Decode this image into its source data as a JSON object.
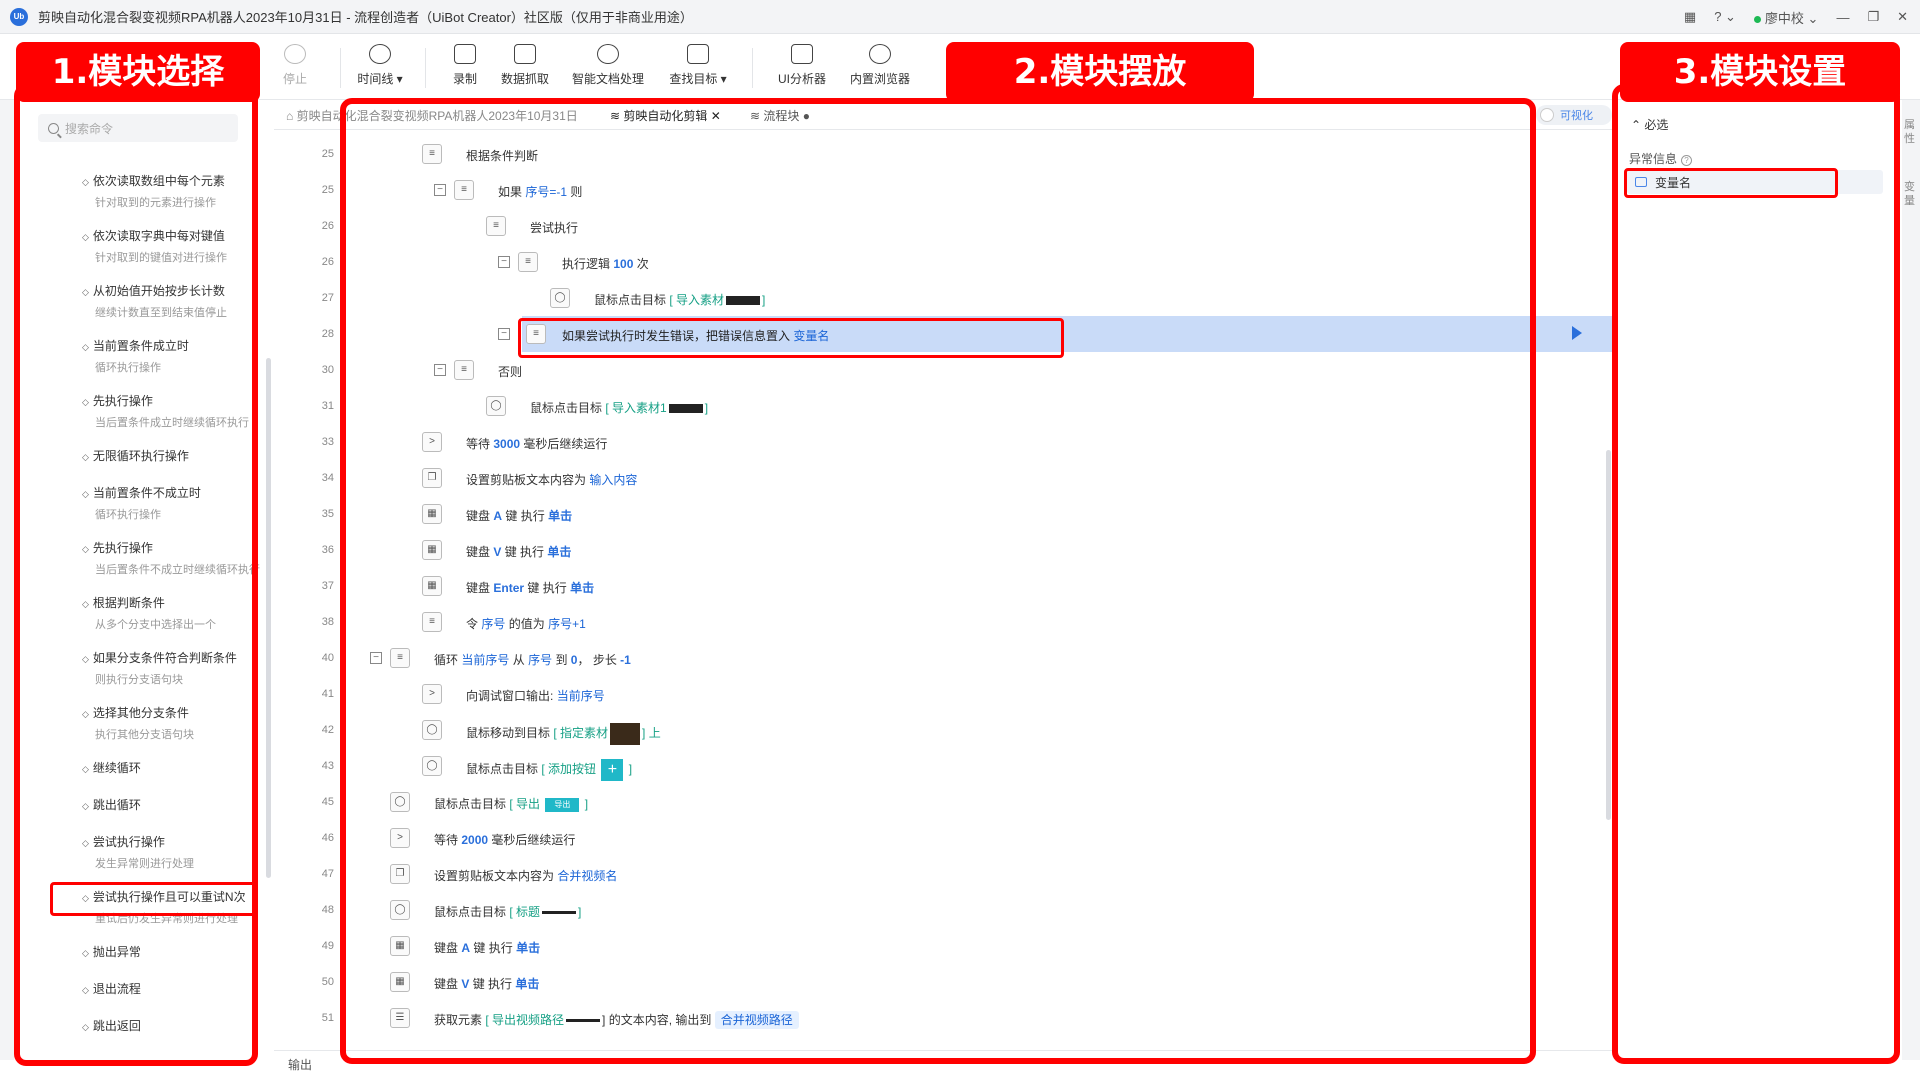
{
  "window": {
    "title": "剪映自动化混合裂变视频RPA机器人2023年10月31日 - 流程创造者（UiBot Creator）社区版（仅用于非商业用途）",
    "logo": "Ub",
    "help": "? ⌄",
    "user": "廖中校 ⌄",
    "minimize": "—",
    "restore": "❐",
    "close": "✕"
  },
  "toolbar": {
    "stop": "停止",
    "timeline": "时间线 ▾",
    "record": "录制",
    "data_capture": "数据抓取",
    "smart_doc": "智能文档处理",
    "find_target": "查找目标 ▾",
    "ui_analyzer": "UI分析器",
    "builtin_browser": "内置浏览器"
  },
  "left": {
    "search_placeholder": "搜索命令",
    "commands": [
      {
        "title": "依次读取数组中每个元素",
        "desc": "针对取到的元素进行操作"
      },
      {
        "title": "依次读取字典中每对键值",
        "desc": "针对取到的键值对进行操作"
      },
      {
        "title": "从初始值开始按步长计数",
        "desc": "继续计数直至到结束值停止"
      },
      {
        "title": "当前置条件成立时",
        "desc": "循环执行操作"
      },
      {
        "title": "先执行操作",
        "desc": "当后置条件成立时继续循环执行"
      },
      {
        "title": "无限循环执行操作",
        "desc": ""
      },
      {
        "title": "当前置条件不成立时",
        "desc": "循环执行操作"
      },
      {
        "title": "先执行操作",
        "desc": "当后置条件不成立时继续循环执行"
      },
      {
        "title": "根据判断条件",
        "desc": "从多个分支中选择出一个"
      },
      {
        "title": "如果分支条件符合判断条件",
        "desc": "则执行分支语句块"
      },
      {
        "title": "选择其他分支条件",
        "desc": "执行其他分支语句块"
      },
      {
        "title": "继续循环",
        "desc": ""
      },
      {
        "title": "跳出循环",
        "desc": ""
      },
      {
        "title": "尝试执行操作",
        "desc": "发生异常则进行处理"
      },
      {
        "title": "尝试执行操作且可以重试N次",
        "desc": "重试后仍发生异常则进行处理"
      },
      {
        "title": "抛出异常",
        "desc": ""
      },
      {
        "title": "退出流程",
        "desc": ""
      },
      {
        "title": "跳出返回",
        "desc": ""
      }
    ]
  },
  "editor": {
    "tabs": {
      "main": "剪映自动化混合裂变视频RPA机器人2023年10月31日",
      "active": "剪映自动化剪辑 ✕",
      "flow": "流程块 ●"
    },
    "visual_toggle": "可视化",
    "output_label": "输出",
    "rows": {
      "r1": {
        "ln": "25",
        "text": "根据条件判断"
      },
      "r2": {
        "ln": "25",
        "a": "如果",
        "b": "序号=-1",
        "c": "则"
      },
      "r3": {
        "ln": "26",
        "text": "尝试执行"
      },
      "r4": {
        "ln": "26",
        "a": "执行逻辑",
        "b": "100",
        "c": "次"
      },
      "r5": {
        "ln": "27",
        "a": "鼠标点击目标",
        "b": "[ 导入素材",
        "c": "]"
      },
      "r6": {
        "ln": "28",
        "a": "如果尝试执行时发生错误，把错误信息置入",
        "b": "变量名"
      },
      "r7": {
        "ln": "30",
        "text": "否则"
      },
      "r8": {
        "ln": "31",
        "a": "鼠标点击目标",
        "b": "[ 导入素材1",
        "c": "]"
      },
      "r9": {
        "ln": "33",
        "a": "等待",
        "b": "3000",
        "c": "毫秒后继续运行"
      },
      "r10": {
        "ln": "34",
        "a": "设置剪贴板文本内容为",
        "b": "输入内容"
      },
      "r11": {
        "ln": "35",
        "a": "键盘",
        "b": "A",
        "c": "键 执行",
        "d": "单击"
      },
      "r12": {
        "ln": "36",
        "a": "键盘",
        "b": "V",
        "c": "键 执行",
        "d": "单击"
      },
      "r13": {
        "ln": "37",
        "a": "键盘",
        "b": "Enter",
        "c": "键 执行",
        "d": "单击"
      },
      "r14": {
        "ln": "38",
        "a": "令",
        "b": "序号",
        "c": "的值为",
        "d": "序号+1"
      },
      "r15": {
        "ln": "40",
        "a": "循环",
        "b": "当前序号",
        "c": "从",
        "d": "序号",
        "e": "到",
        "f": "0",
        "g": "， 步长",
        "h": "-1"
      },
      "r16": {
        "ln": "41",
        "a": "向调试窗口输出:",
        "b": "当前序号"
      },
      "r17": {
        "ln": "42",
        "a": "鼠标移动到目标",
        "b": "[ 指定素材",
        "c": "] 上"
      },
      "r18": {
        "ln": "43",
        "a": "鼠标点击目标",
        "b": "[ 添加按钮",
        "c": "]"
      },
      "r19": {
        "ln": "45",
        "a": "鼠标点击目标",
        "b": "[ 导出",
        "c": "]",
        "chip": "导出"
      },
      "r20": {
        "ln": "46",
        "a": "等待",
        "b": "2000",
        "c": "毫秒后继续运行"
      },
      "r21": {
        "ln": "47",
        "a": "设置剪贴板文本内容为",
        "b": "合并视频名"
      },
      "r22": {
        "ln": "48",
        "a": "鼠标点击目标",
        "b": "[ 标题",
        "c": "]"
      },
      "r23": {
        "ln": "49",
        "a": "键盘",
        "b": "A",
        "c": "键 执行",
        "d": "单击"
      },
      "r24": {
        "ln": "50",
        "a": "键盘",
        "b": "V",
        "c": "键 执行",
        "d": "单击"
      },
      "r25": {
        "ln": "51",
        "a": "获取元素",
        "b": "[ 导出视频路径",
        "c": "] 的文本内容, 输出到",
        "d": "合并视频路径"
      }
    }
  },
  "right": {
    "section": "⌃ 必选",
    "field_label": "异常信息",
    "field_value": "变量名",
    "side_tab_1": "属性",
    "side_tab_2": "变量"
  },
  "annotations": {
    "b1": "1.模块选择",
    "b2": "2.模块摆放",
    "b3": "3.模块设置"
  },
  "colors": {
    "accent": "#2a6fdb",
    "annotation": "#ff0000",
    "selected_row": "#c9dbf8"
  }
}
